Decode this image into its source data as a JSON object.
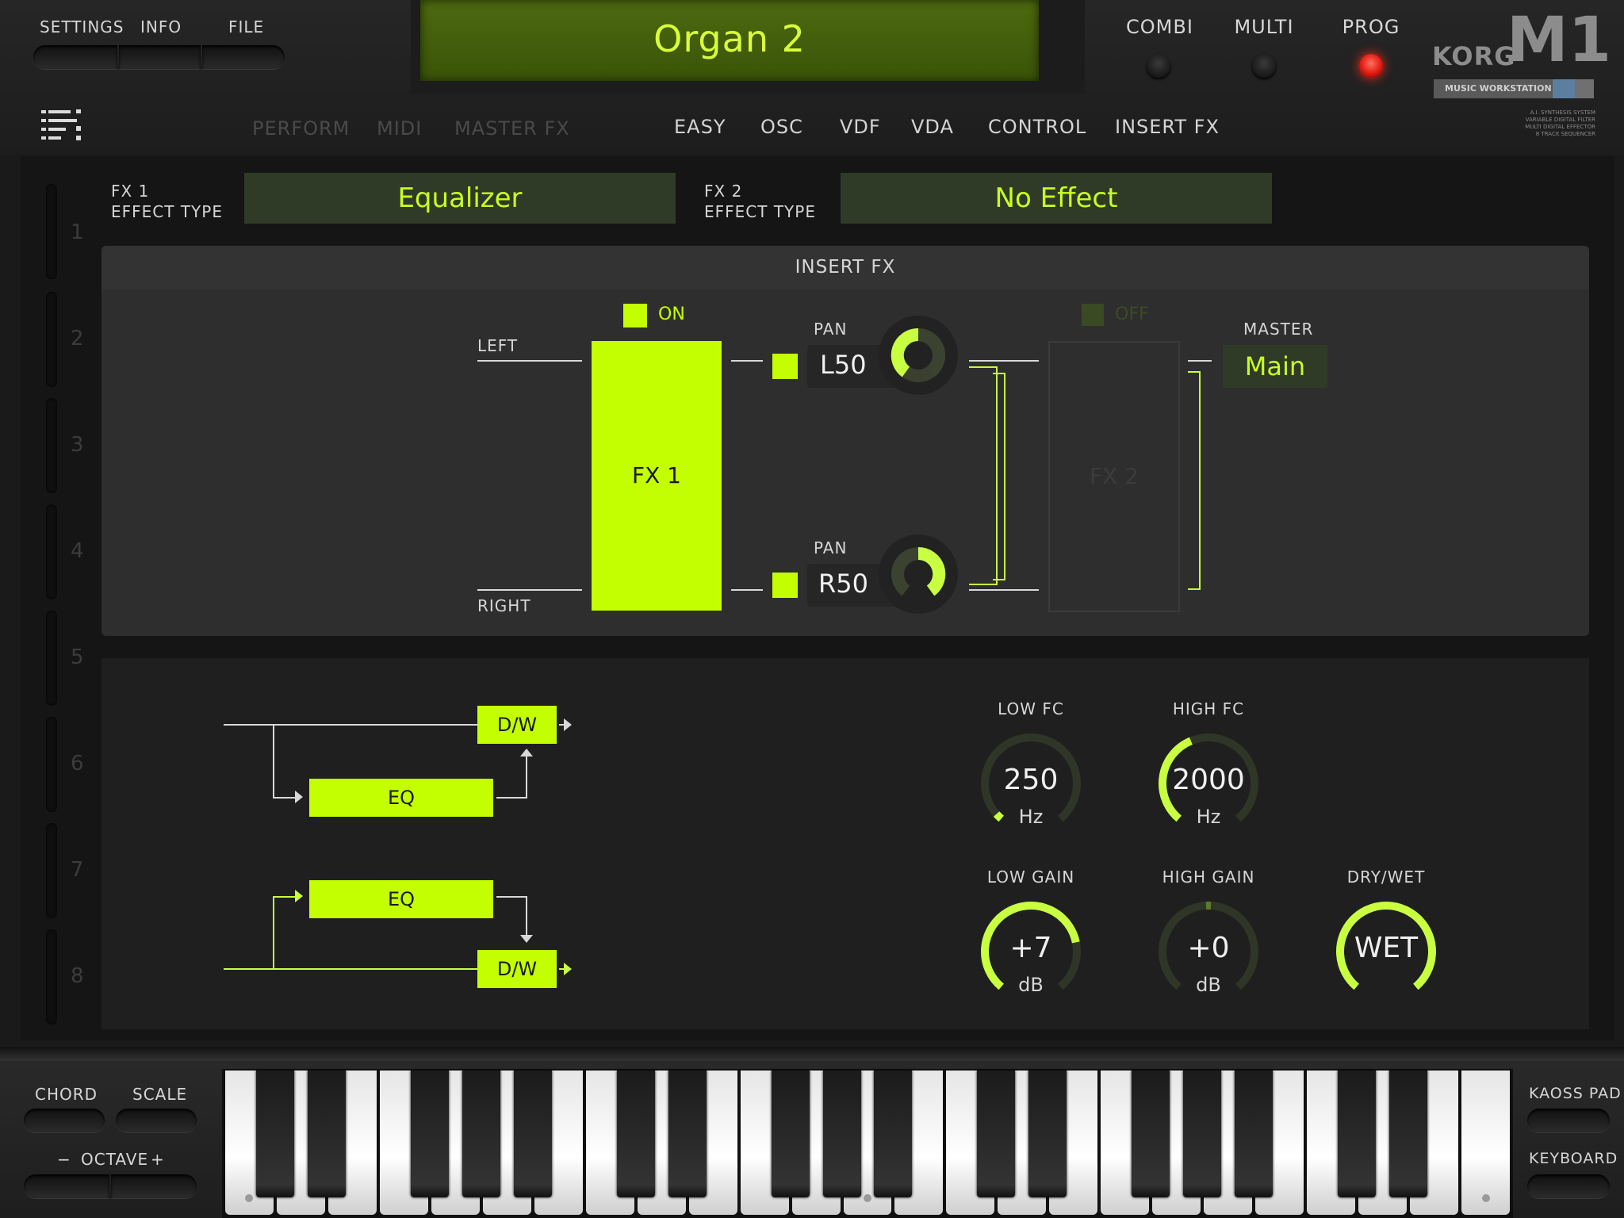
{
  "header": {
    "menu": [
      "SETTINGS",
      "INFO",
      "FILE"
    ],
    "program_name": "Organ 2",
    "modes": [
      {
        "label": "COMBI",
        "active": false
      },
      {
        "label": "MULTI",
        "active": false
      },
      {
        "label": "PROG",
        "active": true
      }
    ],
    "brand": {
      "logo": "KORG",
      "model": "M1",
      "subtitle": "MUSIC WORKSTATION",
      "spec_lines": [
        "A.I. SYNTHESIS SYSTEM",
        "VARIABLE DIGITAL FILTER",
        "MULTI DIGITAL EFFECTOR",
        "8 TRACK SEQUENCER"
      ]
    }
  },
  "tabs": {
    "left": [
      "PERFORM",
      "MIDI",
      "MASTER FX"
    ],
    "right": [
      "EASY",
      "OSC",
      "VDF",
      "VDA",
      "CONTROL",
      "INSERT FX"
    ],
    "active": "INSERT FX"
  },
  "strips": [
    "1",
    "2",
    "3",
    "4",
    "5",
    "6",
    "7",
    "8"
  ],
  "fx": {
    "fx1_label_1": "FX 1",
    "fx1_label_2": "EFFECT TYPE",
    "fx1_type": "Equalizer",
    "fx2_label_1": "FX 2",
    "fx2_label_2": "EFFECT TYPE",
    "fx2_type": "No Effect"
  },
  "routing": {
    "title": "INSERT FX",
    "left": "LEFT",
    "right": "RIGHT",
    "fx1_state": "ON",
    "fx1_block": "FX 1",
    "fx2_state": "OFF",
    "fx2_block": "FX 2",
    "pan_label": "PAN",
    "pan_top": "L50",
    "pan_bottom": "R50",
    "master_label": "MASTER",
    "master_value": "Main"
  },
  "eq_diagram": {
    "dw": "D/W",
    "eq": "EQ"
  },
  "knobs": [
    {
      "label": "LOW FC",
      "value": "250",
      "unit": "Hz",
      "level": 0.03
    },
    {
      "label": "HIGH FC",
      "value": "2000",
      "unit": "Hz",
      "level": 0.42
    },
    {
      "label": "LOW GAIN",
      "value": "+7",
      "unit": "dB",
      "level": 0.78
    },
    {
      "label": "HIGH GAIN",
      "value": "+0",
      "unit": "dB",
      "level": 0.5
    },
    {
      "label": "DRY/WET",
      "value": "WET",
      "unit": "",
      "level": 1.0
    }
  ],
  "bottom": {
    "chord": "CHORD",
    "scale": "SCALE",
    "octave": "OCTAVE",
    "oct_minus": "−",
    "oct_plus": "+",
    "kaoss": "KAOSS PAD",
    "keyboard": "KEYBOARD"
  },
  "colors": {
    "accent": "#c4ff00",
    "prog_led": "#e01a10",
    "panel": "#2e2e2e"
  }
}
